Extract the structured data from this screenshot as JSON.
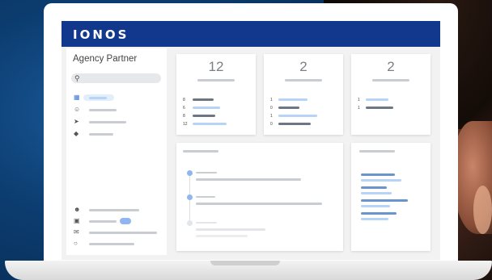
{
  "app": {
    "logo": "IONOS",
    "account_name": "Agency Partner"
  },
  "colors": {
    "topbar": "#11388d",
    "accent": "#6a94cc",
    "accent_light": "#b7d3f7"
  },
  "icons": {
    "search": "search-icon",
    "nav": [
      "dashboard-icon",
      "customers-icon",
      "rocket-icon",
      "tag-icon"
    ],
    "footer": [
      "user-icon",
      "invoice-icon",
      "chat-icon",
      "help-icon"
    ]
  },
  "stats": [
    {
      "value": "12",
      "rows": [
        "8",
        "6",
        "8",
        "12"
      ]
    },
    {
      "value": "2",
      "rows": [
        "1",
        "0",
        "1",
        "0"
      ]
    },
    {
      "value": "2",
      "rows": [
        "1",
        "1"
      ]
    }
  ]
}
